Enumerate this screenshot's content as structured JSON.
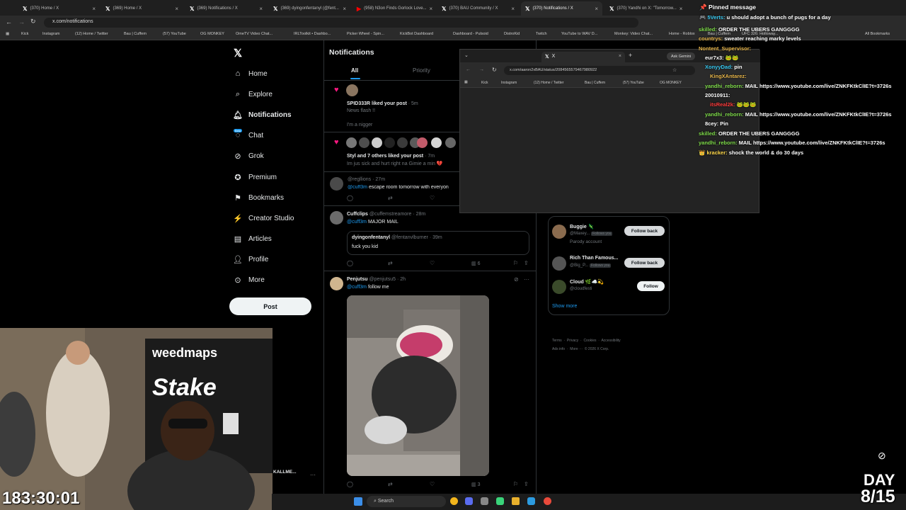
{
  "browser": {
    "tabs": [
      {
        "title": "(370) Home / X",
        "favicon": "x-logo"
      },
      {
        "title": "(369) Home / X",
        "favicon": "x-logo"
      },
      {
        "title": "(369) Notifications / X",
        "favicon": "x-logo"
      },
      {
        "title": "(369) dyingonfentanyl (@fent...",
        "favicon": "x-logo"
      },
      {
        "title": "(958) N3on Finds Gorlock Love...",
        "favicon": "youtube-logo"
      },
      {
        "title": "(370) BAU Community / X",
        "favicon": "x-logo"
      },
      {
        "title": "(370) Notifications / X",
        "favicon": "x-logo",
        "active": true
      },
      {
        "title": "(370) Yandhi on X: \"Tomorrow...",
        "favicon": "x-logo"
      }
    ],
    "url": "x.com/notifications",
    "bookmarks": [
      "Kick",
      "Instagram",
      "(12) Home / Twitter",
      "Bau | Cuffem",
      "(57) YouTube",
      "OG MONKEY",
      "OmeTV Video Chat...",
      "IRLToolkit • Dashbo...",
      "Picker Wheel - Spin...",
      "KickBot Dashboard",
      "Dashboard - Pulsoid",
      "DistroKid",
      "Twitch",
      "YouTube to WAV D...",
      "Monkey: Video Chat...",
      "Home - Roblox",
      "Bau | Cuffem",
      "UFC 326: Holloway...",
      "All Bookmarks"
    ]
  },
  "sidebar": {
    "items": [
      {
        "label": "Home",
        "icon": "home-icon"
      },
      {
        "label": "Explore",
        "icon": "search-icon"
      },
      {
        "label": "Notifications",
        "icon": "bell-icon",
        "active": true
      },
      {
        "label": "Chat",
        "icon": "chat-icon",
        "badge": "Beta"
      },
      {
        "label": "Grok",
        "icon": "grok-icon"
      },
      {
        "label": "Premium",
        "icon": "premium-icon"
      },
      {
        "label": "Bookmarks",
        "icon": "bookmark-icon"
      },
      {
        "label": "Creator Studio",
        "icon": "creator-studio-icon"
      },
      {
        "label": "Articles",
        "icon": "articles-icon"
      },
      {
        "label": "Profile",
        "icon": "profile-icon"
      },
      {
        "label": "More",
        "icon": "more-icon"
      }
    ],
    "post_label": "Post",
    "account_name": "KALLME..."
  },
  "main": {
    "title": "Notifications",
    "tabs": [
      "All",
      "Priority"
    ],
    "n1": {
      "text": "SPID333R liked your post",
      "time": "· 5m",
      "line1": "News flash !!",
      "line2": "I'm a nigger"
    },
    "n2": {
      "text": "Styl and 7 others liked your post",
      "time": "· 7m",
      "line1": "Im jus sick and hurt right na Gimie a min 💔"
    },
    "n3": {
      "handle": "@regllions",
      "time": "· 27m",
      "mention": "@cuff3m",
      "text": " escape room tomorrow with everyon"
    },
    "n4": {
      "name": "Cuffclips",
      "handle": "@cuffemstreamore",
      "time": "· 28m",
      "mention": "@cuff3m",
      "text": " MAJOR MAIL",
      "quote_name": "dyingonfentanyl",
      "quote_handle": "@fentanvlburner",
      "quote_time": "· 39m",
      "quote_text": "fuck you kid",
      "views": "6"
    },
    "n5": {
      "name": "Penjutsu",
      "handle": "@penjutsu5",
      "time": "· 2h",
      "mention": "@cuff3m",
      "text": " follow me",
      "views": "3"
    }
  },
  "popup": {
    "tab_title": "X",
    "url": "x.com/aaron2xBAU/status/2084565579467980922",
    "ask_label": "Ask Gemini",
    "bookmarks": [
      "Kick",
      "Instagram",
      "(12) Home / Twitter",
      "Bau | Cuffem",
      "(57) YouTube",
      "OG MONKEY"
    ]
  },
  "who_to_follow": {
    "items": [
      {
        "name": "Buggie 🦎",
        "handle": "@Maxey...",
        "follows_you": "Follows you",
        "sub": "Parody account",
        "button": "Follow back"
      },
      {
        "name": "Rich Than Famous...",
        "handle": "@Big_P...",
        "follows_you": "Follows you",
        "button": "Follow back"
      },
      {
        "name": "Cloud 🌿☁️💫",
        "handle": "@cloudfesti",
        "button": "Follow"
      }
    ],
    "show_more": "Show more",
    "footer1": "Terms  ·  Privacy  ·  Cookies  ·  Accessibility",
    "footer2": "Ads info  ·  More ···  © 2026 X Corp."
  },
  "chat": {
    "pinned": "Pinned message",
    "messages": [
      {
        "user": "5Verts:",
        "text": "u should adopt a bunch of pugs for a day",
        "color": "#ffffff"
      },
      {
        "user": "skilled:",
        "text": "ORDER THE UBERS GANGGGG",
        "color": "#7fdc4a"
      },
      {
        "user": "countrys:",
        "text": "sweater reaching marky levels",
        "color": "#e8b64a"
      },
      {
        "user": "Nontent_Supervisor:",
        "text": "",
        "color": "#e8b64a"
      },
      {
        "user": "eur7x3:",
        "text": "🐸🐸",
        "color": "#ffffff"
      },
      {
        "user": "XonyyDad:",
        "text": "pin",
        "color": "#37c8f0"
      },
      {
        "user": "KingXAntarez:",
        "text": "",
        "color": "#e8b64a"
      },
      {
        "user": "yandhi_reborn:",
        "text": "MAIL https://www.youtube.com/live/ZNKFKtkClIE?t=3726s",
        "color": "#7fdc4a"
      },
      {
        "user": "20010911:",
        "text": "",
        "color": "#ffffff"
      },
      {
        "user": "itsReal2k:",
        "text": "🐸🐸🐸",
        "color": "#ff3b3b"
      },
      {
        "user": "yandhi_reborn:",
        "text": "MAIL https://www.youtube.com/live/ZNKFKtkClIE?t=3726s",
        "color": "#7fdc4a"
      },
      {
        "user": "8cey:",
        "text": "Pin",
        "color": "#ffffff"
      },
      {
        "user": "skilled:",
        "text": "ORDER THE UBERS GANGGGG",
        "color": "#7fdc4a"
      },
      {
        "user": "yandhi_reborn:",
        "text": "MAIL https://www.youtube.com/live/ZNKFKtkClIE?t=3726s",
        "color": "#7fdc4a"
      },
      {
        "user": "kracker:",
        "text": "shock the world & do 30 days",
        "color": "#ffd84a"
      }
    ]
  },
  "overlay": {
    "timer": "183:30:01",
    "day_label": "DAY",
    "day_value": "8/15",
    "banner_top": "weedmaps",
    "banner_bottom": "Stake"
  },
  "taskbar": {
    "search_label": "Search"
  }
}
